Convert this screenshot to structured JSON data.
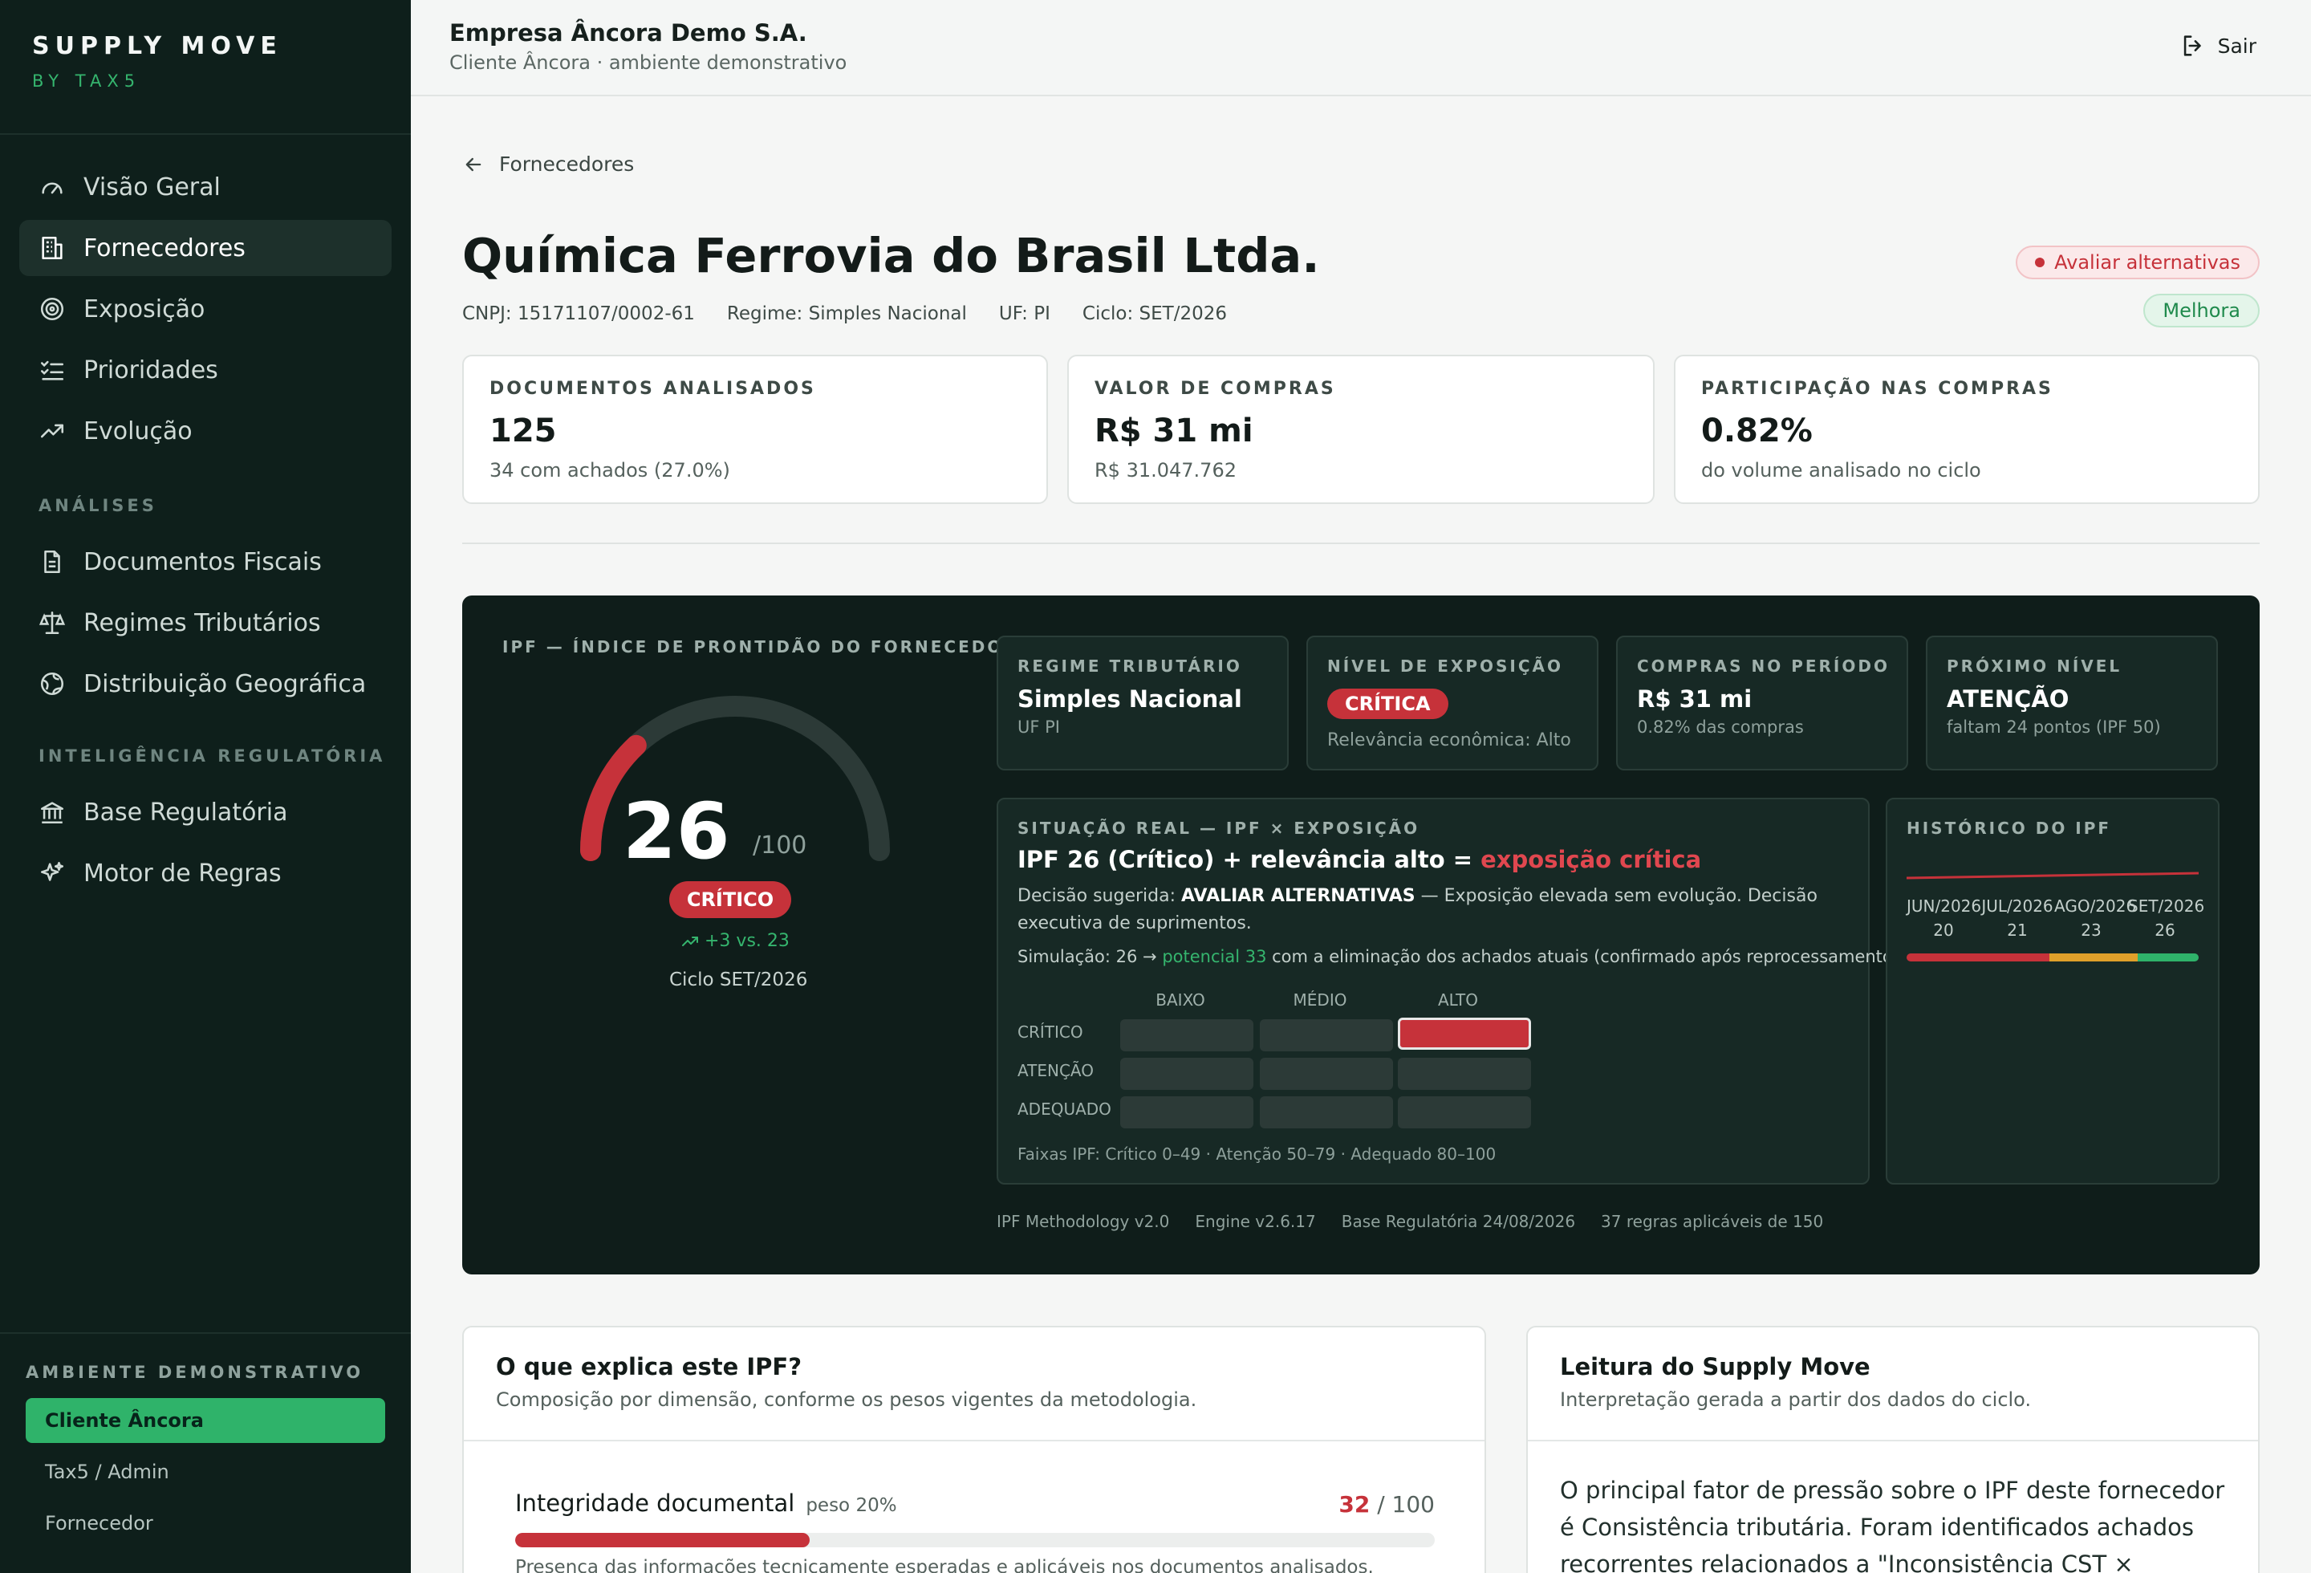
{
  "sidebar": {
    "brand_title": "SUPPLY MOVE",
    "brand_sub": "BY TAX5",
    "nav": [
      {
        "label": "Visão Geral",
        "icon": "gauge-icon"
      },
      {
        "label": "Fornecedores",
        "icon": "building-icon",
        "active": true
      },
      {
        "label": "Exposição",
        "icon": "target-icon"
      },
      {
        "label": "Prioridades",
        "icon": "checklist-icon"
      },
      {
        "label": "Evolução",
        "icon": "trending-up-icon"
      }
    ],
    "section_analises": "ANÁLISES",
    "analises": [
      {
        "label": "Documentos Fiscais",
        "icon": "document-icon"
      },
      {
        "label": "Regimes Tributários",
        "icon": "scale-icon"
      },
      {
        "label": "Distribuição Geográfica",
        "icon": "globe-icon"
      }
    ],
    "section_intel": "INTELIGÊNCIA REGULATÓRIA",
    "intel": [
      {
        "label": "Base Regulatória",
        "icon": "bank-icon"
      },
      {
        "label": "Motor de Regras",
        "icon": "sparkles-icon"
      }
    ],
    "env_label": "AMBIENTE DEMONSTRATIVO",
    "env_options": [
      "Cliente Âncora",
      "Tax5 / Admin",
      "Fornecedor"
    ]
  },
  "header": {
    "org_name": "Empresa Âncora Demo S.A.",
    "org_sub": "Cliente Âncora · ambiente demonstrativo",
    "logout": "Sair"
  },
  "page": {
    "back_label": "Fornecedores",
    "title": "Química Ferrovia do Brasil Ltda.",
    "cnpj": "CNPJ: 15171107/0002-61",
    "regime": "Regime: Simples Nacional",
    "uf": "UF: PI",
    "ciclo": "Ciclo: SET/2026",
    "badge_alert": "Avaliar alternativas",
    "badge_trend": "Melhora",
    "colors": {
      "critical": "#c6323a",
      "positive": "#2fb36a",
      "warning": "#e0a02a"
    }
  },
  "stats": [
    {
      "label": "DOCUMENTOS ANALISADOS",
      "value": "125",
      "sub": "34 com achados (27.0%)"
    },
    {
      "label": "VALOR DE COMPRAS",
      "value": "R$ 31 mi",
      "sub": "R$ 31.047.762"
    },
    {
      "label": "PARTICIPAÇÃO NAS COMPRAS",
      "value": "0.82%",
      "sub": "do volume analisado no ciclo"
    }
  ],
  "ipf": {
    "title": "IPF — ÍNDICE DE PRONTIDÃO DO FORNECEDOR",
    "score": "26",
    "max": "/100",
    "score_fraction": 0.26,
    "level": "CRÍTICO",
    "trend": "+3 vs. 23",
    "cycle": "Ciclo SET/2026",
    "cards": [
      {
        "label": "REGIME TRIBUTÁRIO",
        "value": "Simples Nacional",
        "sub": "UF PI"
      },
      {
        "label": "NÍVEL DE EXPOSIÇÃO",
        "badge": "CRÍTICA",
        "sub": "Relevância econômica: Alto"
      },
      {
        "label": "COMPRAS NO PERÍODO",
        "value": "R$ 31 mi",
        "sub": "0.82% das compras"
      },
      {
        "label": "PRÓXIMO NÍVEL",
        "value": "ATENÇÃO",
        "sub": "faltam 24 pontos (IPF 50)"
      }
    ],
    "situation": {
      "label": "SITUAÇÃO REAL — IPF × EXPOSIÇÃO",
      "head_prefix": "IPF 26 (Crítico) + relevância alto = ",
      "head_highlight": "exposição crítica",
      "decision_prefix": "Decisão sugerida: ",
      "decision_bold": "AVALIAR ALTERNATIVAS",
      "decision_rest": " — Exposição elevada sem evolução. Decisão executiva de suprimentos.",
      "sim_prefix": "Simulação: 26 → ",
      "sim_highlight": "potencial 33",
      "sim_rest": " com a eliminação dos achados atuais (confirmado após reprocessamento).",
      "columns": [
        "BAIXO",
        "MÉDIO",
        "ALTO"
      ],
      "rows": [
        "CRÍTICO",
        "ATENÇÃO",
        "ADEQUADO"
      ],
      "highlight_cell": {
        "row": "CRÍTICO",
        "column": "ALTO"
      },
      "bands": "Faixas IPF: Crítico 0–49 · Atenção 50–79 · Adequado 80–100"
    },
    "history": {
      "label": "HISTÓRICO DO IPF",
      "months": [
        {
          "month": "JUN/2026",
          "value": "20"
        },
        {
          "month": "JUL/2026",
          "value": "21"
        },
        {
          "month": "AGO/2026",
          "value": "23"
        },
        {
          "month": "SET/2026",
          "value": "26"
        }
      ]
    },
    "footer": [
      "IPF Methodology v2.0",
      "Engine v2.6.17",
      "Base Regulatória 24/08/2026",
      "37 regras aplicáveis de 150"
    ]
  },
  "explain": {
    "title": "O que explica este IPF?",
    "sub": "Composição por dimensão, conforme os pesos vigentes da metodologia.",
    "dimension": {
      "name": "Integridade documental",
      "weight": "peso 20%",
      "score": "32",
      "max": " / 100",
      "fraction": 0.32,
      "desc": "Presença das informações tecnicamente esperadas e aplicáveis nos documentos analisados."
    }
  },
  "reading": {
    "title": "Leitura do Supply Move",
    "sub": "Interpretação gerada a partir dos dados do ciclo.",
    "text": "O principal fator de pressão sobre o IPF deste fornecedor é Consistência tributária. Foram identificados achados recorrentes relacionados a \"Inconsistência CST × cClassTrib\""
  }
}
